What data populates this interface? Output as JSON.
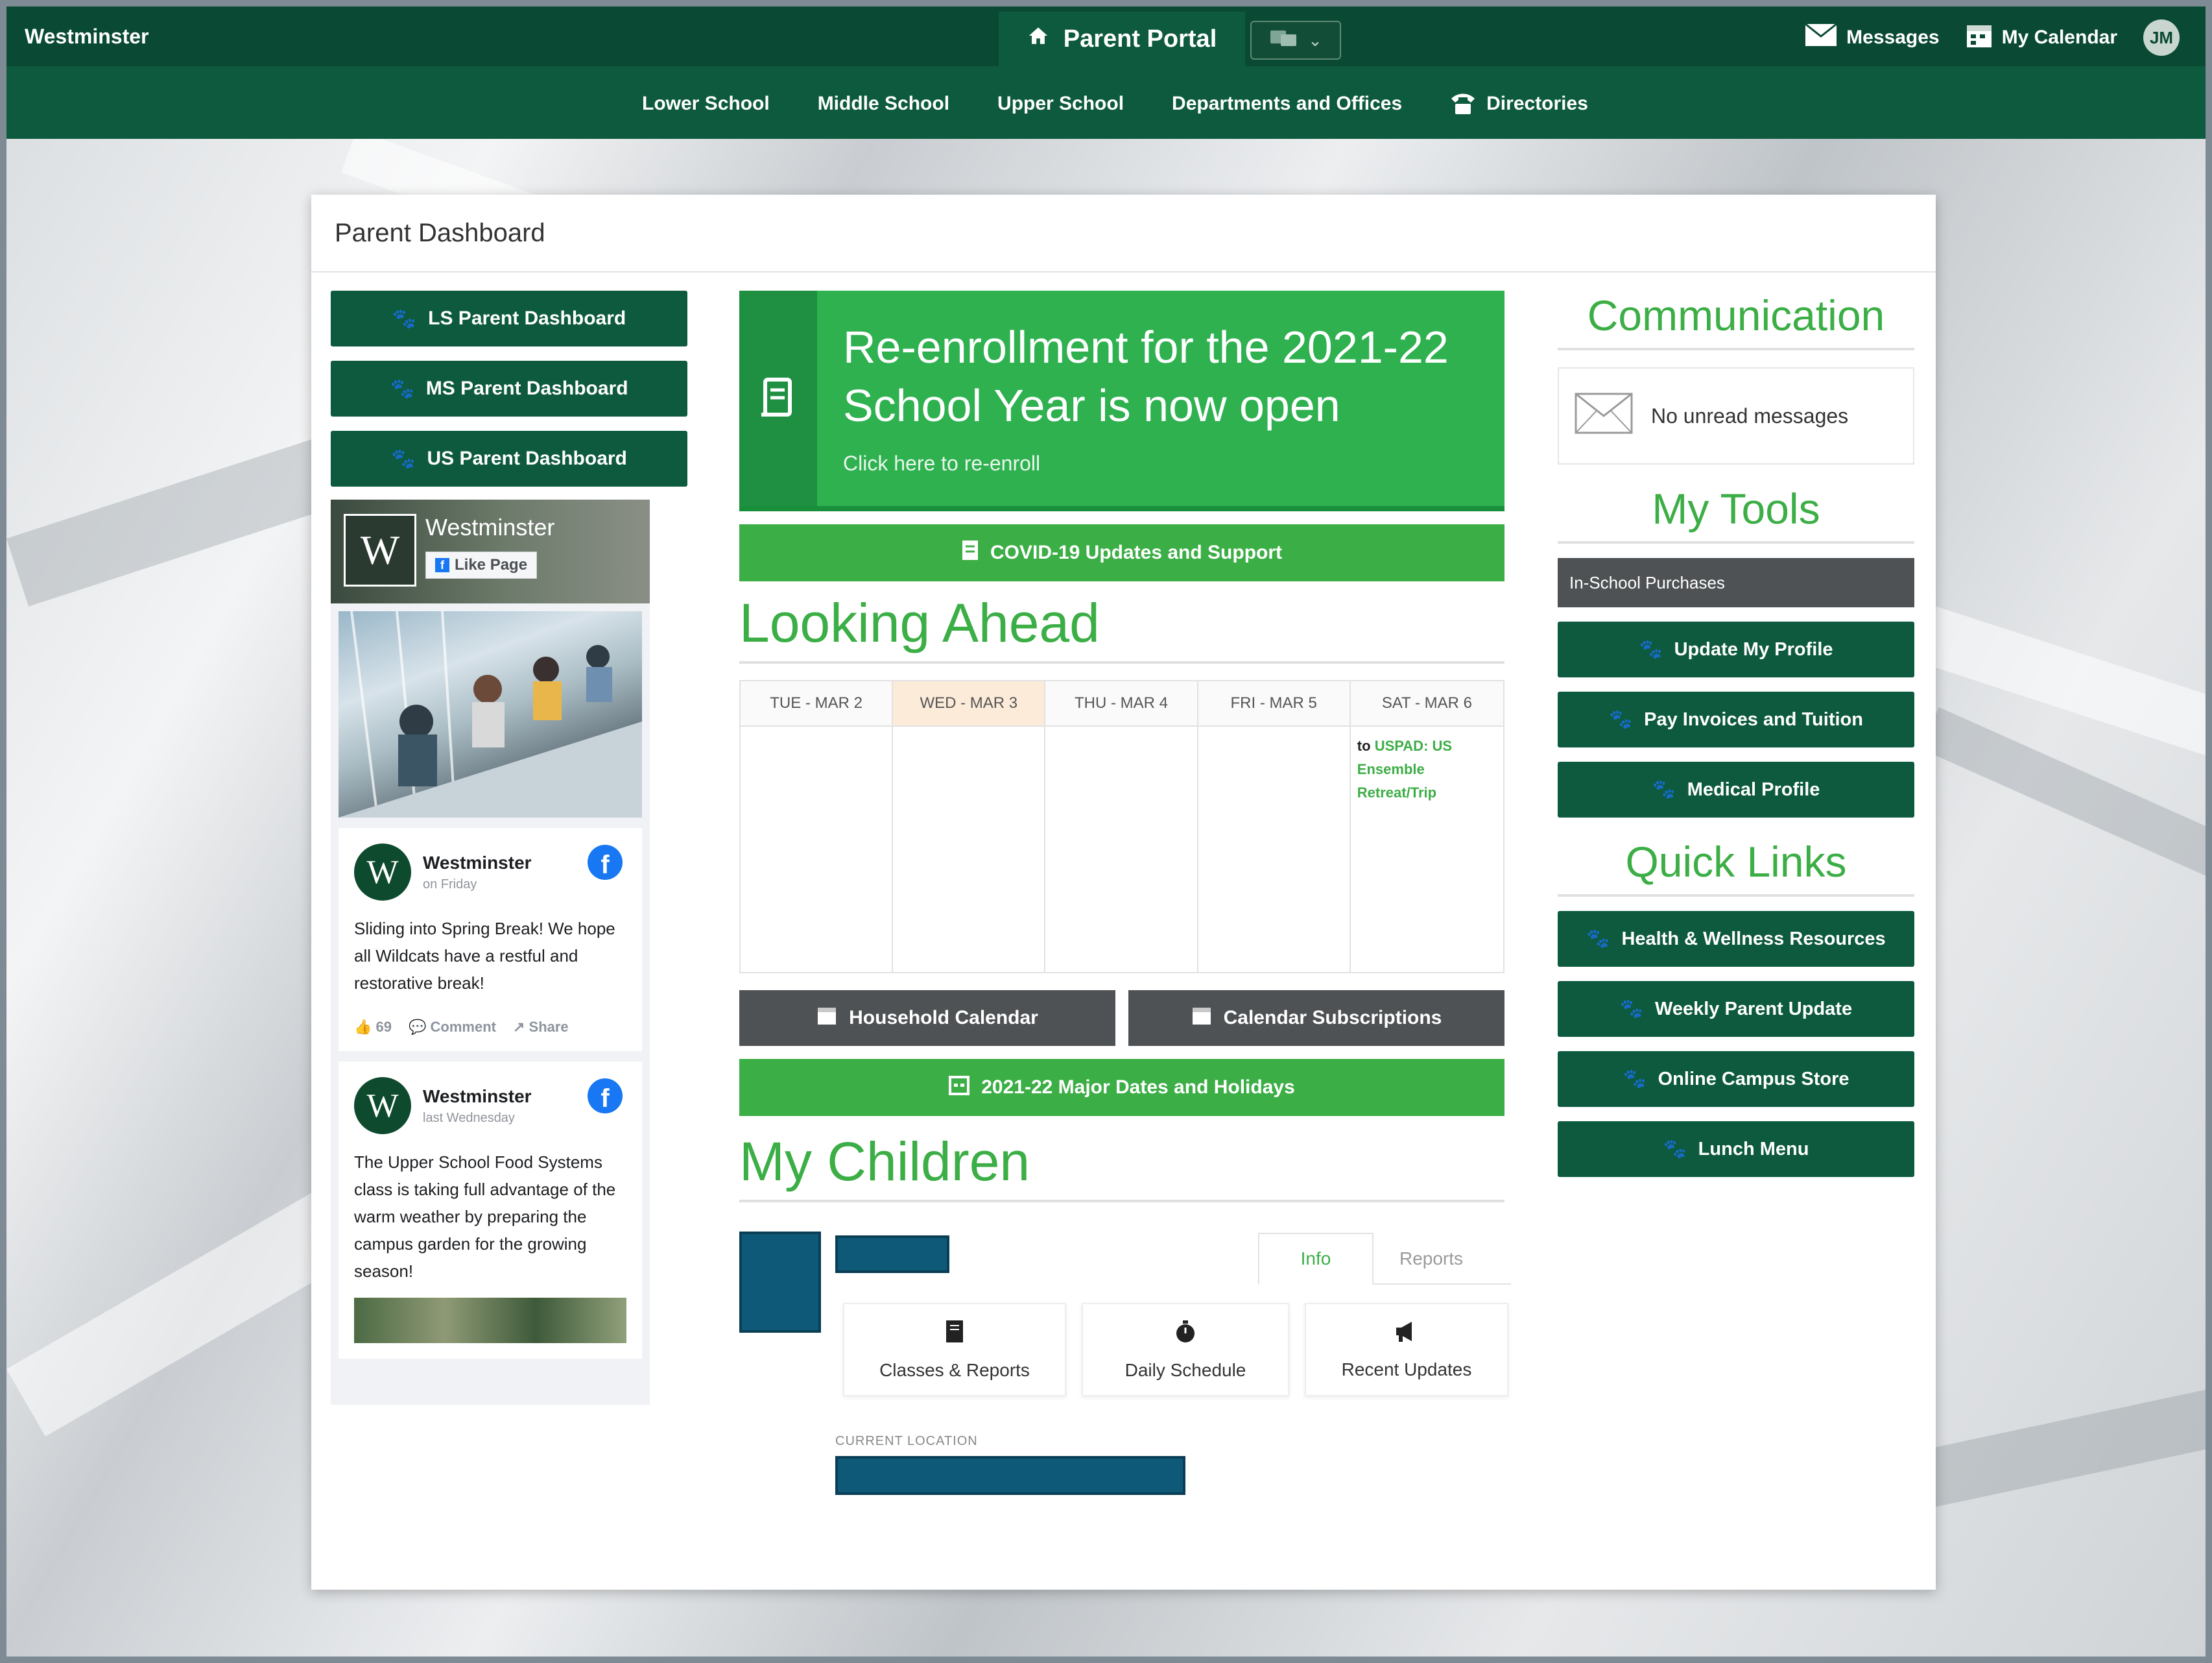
{
  "topbar": {
    "brand": "Westminster",
    "portal_label": "Parent Portal",
    "messages_label": "Messages",
    "calendar_label": "My Calendar",
    "avatar_initials": "JM"
  },
  "subnav": {
    "items": [
      "Lower School",
      "Middle School",
      "Upper School",
      "Departments and Offices",
      "Directories"
    ]
  },
  "panel": {
    "title": "Parent Dashboard"
  },
  "left": {
    "buttons": [
      "LS Parent Dashboard",
      "MS Parent Dashboard",
      "US Parent Dashboard"
    ],
    "facebook": {
      "page_name": "Westminster",
      "like_label": "Like Page",
      "posts": [
        {
          "author": "Westminster",
          "time": "on Friday",
          "text": "Sliding into Spring Break! We hope all Wildcats have a restful and restorative break!",
          "likes": "69",
          "comment_label": "Comment",
          "share_label": "Share"
        },
        {
          "author": "Westminster",
          "time": "last Wednesday",
          "text": "The Upper School Food Systems class is taking full advantage of the warm weather by preparing the campus garden for the growing season!"
        }
      ]
    }
  },
  "center": {
    "banner": {
      "title": "Re-enrollment for the 2021-22 School Year is now open",
      "subtitle": "Click here to re-enroll"
    },
    "covid_button": "COVID-19 Updates and Support",
    "looking_ahead_title": "Looking Ahead",
    "calendar": {
      "days": [
        {
          "label": "TUE - MAR 2",
          "today": false,
          "event": ""
        },
        {
          "label": "WED - MAR 3",
          "today": true,
          "event": ""
        },
        {
          "label": "THU - MAR 4",
          "today": false,
          "event": ""
        },
        {
          "label": "FRI - MAR 5",
          "today": false,
          "event": ""
        },
        {
          "label": "SAT - MAR 6",
          "today": false,
          "event_prefix": "to",
          "event": "USPAD: US Ensemble Retreat/Trip"
        }
      ]
    },
    "household_calendar": "Household Calendar",
    "calendar_subscriptions": "Calendar Subscriptions",
    "major_dates": "2021-22 Major Dates and Holidays",
    "my_children_title": "My Children",
    "tabs": [
      "Info",
      "Reports"
    ],
    "tiles": [
      "Classes & Reports",
      "Daily Schedule",
      "Recent Updates"
    ],
    "current_location_label": "CURRENT LOCATION"
  },
  "right": {
    "communication_title": "Communication",
    "no_messages": "No unread messages",
    "my_tools_title": "My Tools",
    "in_school_purchases": "In-School Purchases",
    "tools": [
      "Update My Profile",
      "Pay Invoices and Tuition",
      "Medical Profile"
    ],
    "quick_links_title": "Quick Links",
    "links": [
      "Health & Wellness Resources",
      "Weekly Parent Update",
      "Online Campus Store",
      "Lunch Menu"
    ]
  },
  "colors": {
    "dark_green": "#0a4a34",
    "green": "#0d5a3e",
    "bright_green": "#3cae46",
    "gray_button": "#4f5254",
    "today_highlight": "#fdebd9",
    "redacted_blue": "#0f5978"
  }
}
